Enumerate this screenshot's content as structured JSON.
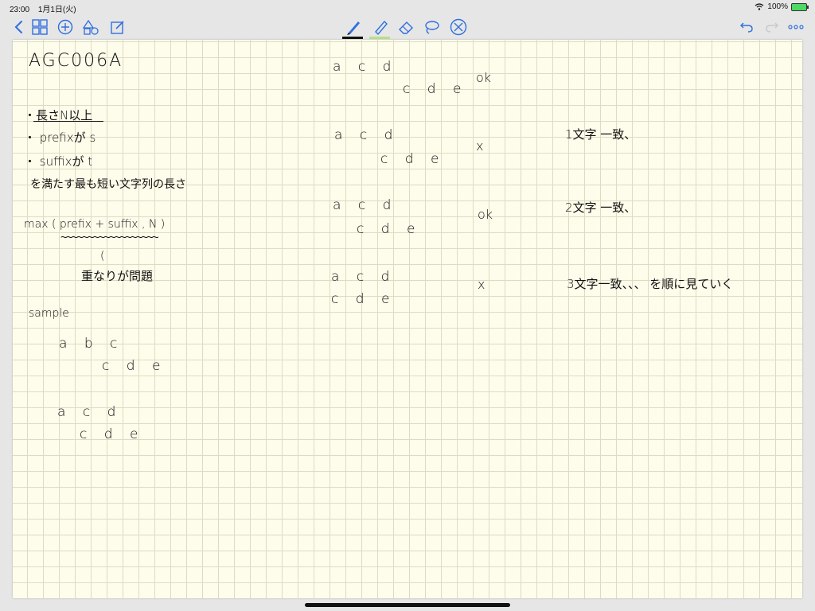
{
  "status": {
    "time": "23:00",
    "date": "1月1日(火)",
    "battery": "100%"
  },
  "colors": {
    "accent": "#2f6fe0",
    "paper": "#fefcea",
    "grid": "#dcdcc6",
    "ink": "#111111",
    "highlighter": "#b9e08a"
  },
  "toolbar": {
    "icons": [
      "back-icon",
      "grid-icon",
      "add-icon",
      "shapes-icon",
      "edit-icon",
      "pen-icon",
      "highlighter-icon",
      "eraser-icon",
      "lasso-icon",
      "close-circle-icon",
      "undo-icon",
      "redo-icon",
      "more-icon"
    ]
  },
  "note": {
    "title": "AGC006A",
    "conditions": [
      "・長さN以上",
      "・ prefixが s",
      "・ suffixが t"
    ],
    "condition_summary": "を満たす最も短い文字列の長さ",
    "formula": "max ( prefix + suffix , N )",
    "formula_mark": "(",
    "formula_note": "重なりが問題",
    "sample_label": "sample",
    "sample1": {
      "row1": "a b c",
      "row2": "c d e"
    },
    "sample2": {
      "row1": "a c d",
      "row2": "c d e"
    },
    "trials": [
      {
        "top": "a c d",
        "bottom": "c d e",
        "result": "ok",
        "note": ""
      },
      {
        "top": "a c d",
        "bottom": "c d e",
        "result": "x",
        "note": "1文字 一致、"
      },
      {
        "top": "a c d",
        "bottom": "c d e",
        "result": "ok",
        "note": "2文字 一致、"
      },
      {
        "top": "a c d",
        "bottom": "c d e",
        "result": "x",
        "note": "3文字一致、、、 を順に見ていく"
      }
    ]
  }
}
